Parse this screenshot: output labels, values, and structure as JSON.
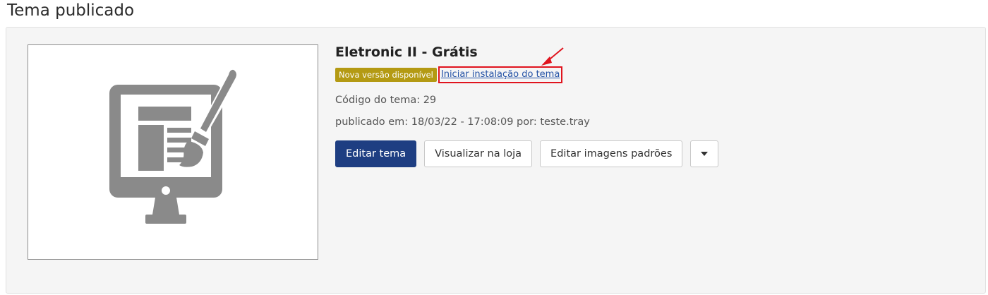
{
  "page": {
    "title": "Tema publicado"
  },
  "theme": {
    "name": "Eletronic II - Grátis",
    "badge": "Nova versão disponível",
    "install_link": "Iniciar instalação do tema",
    "code": "Código do tema: 29",
    "published": "publicado em: 18/03/22 - 17:08:09 por: teste.tray",
    "thumbnail_icon": "theme-editor-monitor-brush-icon"
  },
  "actions": {
    "edit": "Editar tema",
    "view": "Visualizar na loja",
    "edit_images": "Editar imagens padrões",
    "more_icon": "caret-down-icon"
  },
  "colors": {
    "badge": "#b49a13",
    "primary": "#1e3e82",
    "link": "#2452a6",
    "highlight": "#e0141e",
    "icon": "#8a8a8a"
  }
}
